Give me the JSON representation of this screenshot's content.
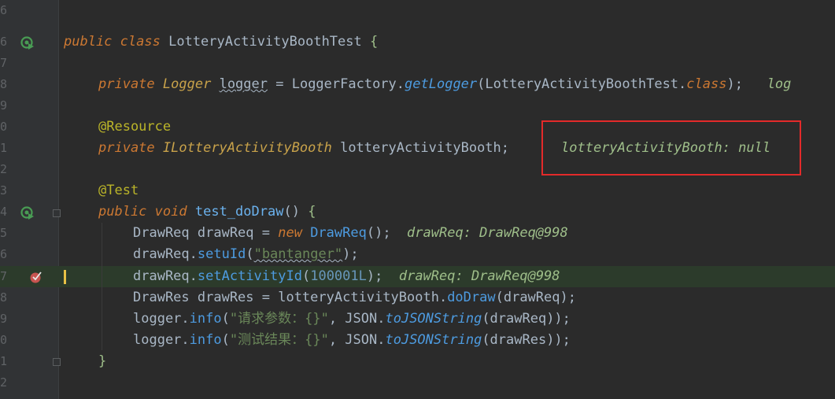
{
  "gutter": {
    "line_numbers": [
      "6",
      "7",
      "8",
      "9",
      "0",
      "1",
      "2",
      "3",
      "4",
      "5",
      "6",
      "7",
      "8",
      "9",
      "0",
      "1",
      "2"
    ]
  },
  "code": {
    "l1": {
      "kw1": "public",
      "kw2": "class",
      "name": "LotteryActivityBoothTest",
      "brace": "{"
    },
    "l3": {
      "kw": "private",
      "type": "Logger",
      "var": "logger",
      "eq": " = ",
      "factory": "LoggerFactory",
      "dot": ".",
      "method": "getLogger",
      "open": "(",
      "arg": "LotteryActivityBoothTest",
      "dot2": ".",
      "cls": "class",
      "close": ");",
      "hint": "log"
    },
    "l5": {
      "ann": "@Resource"
    },
    "l6": {
      "kw": "private",
      "type": "ILotteryActivityBooth",
      "var": " lotteryActivityBooth;",
      "hint": "lotteryActivityBooth: null"
    },
    "l8": {
      "ann": "@Test"
    },
    "l9": {
      "kw1": "public",
      "kw2": "void",
      "name": "test_doDraw",
      "parens": "() ",
      "brace": "{"
    },
    "l10": {
      "pre": "DrawReq drawReq = ",
      "kw": "new",
      "type": " DrawReq",
      "post": "();",
      "hint": "drawReq: DrawReq@998"
    },
    "l11": {
      "obj": "drawReq",
      "dot": ".",
      "method": "setuId",
      "open": "(",
      "str": "\"bantanger\"",
      "close": ");"
    },
    "l12": {
      "obj": "drawReq",
      "dot": ".",
      "method": "setActivityId",
      "open": "(",
      "num": "100001L",
      "close": ");",
      "hint": "drawReq: DrawReq@998"
    },
    "l13": {
      "pre": "DrawRes drawRes = lotteryActivityBooth",
      "dot": ".",
      "method": "doDraw",
      "post": "(drawReq);"
    },
    "l14": {
      "obj": "logger",
      "dot": ".",
      "method": "info",
      "open": "(",
      "str": "\"请求参数：{}\"",
      "mid": ", JSON.",
      "method2": "toJSONString",
      "post": "(drawReq));"
    },
    "l15": {
      "obj": "logger",
      "dot": ".",
      "method": "info",
      "open": "(",
      "str": "\"测试结果：{}\"",
      "mid": ", JSON.",
      "method2": "toJSONString",
      "post": "(drawRes));"
    },
    "l16": {
      "brace": "}"
    }
  },
  "colors": {
    "background": "#2b2b2b",
    "highlight_line": "#2c3b2b",
    "annotation_box": "#e32a2a"
  }
}
